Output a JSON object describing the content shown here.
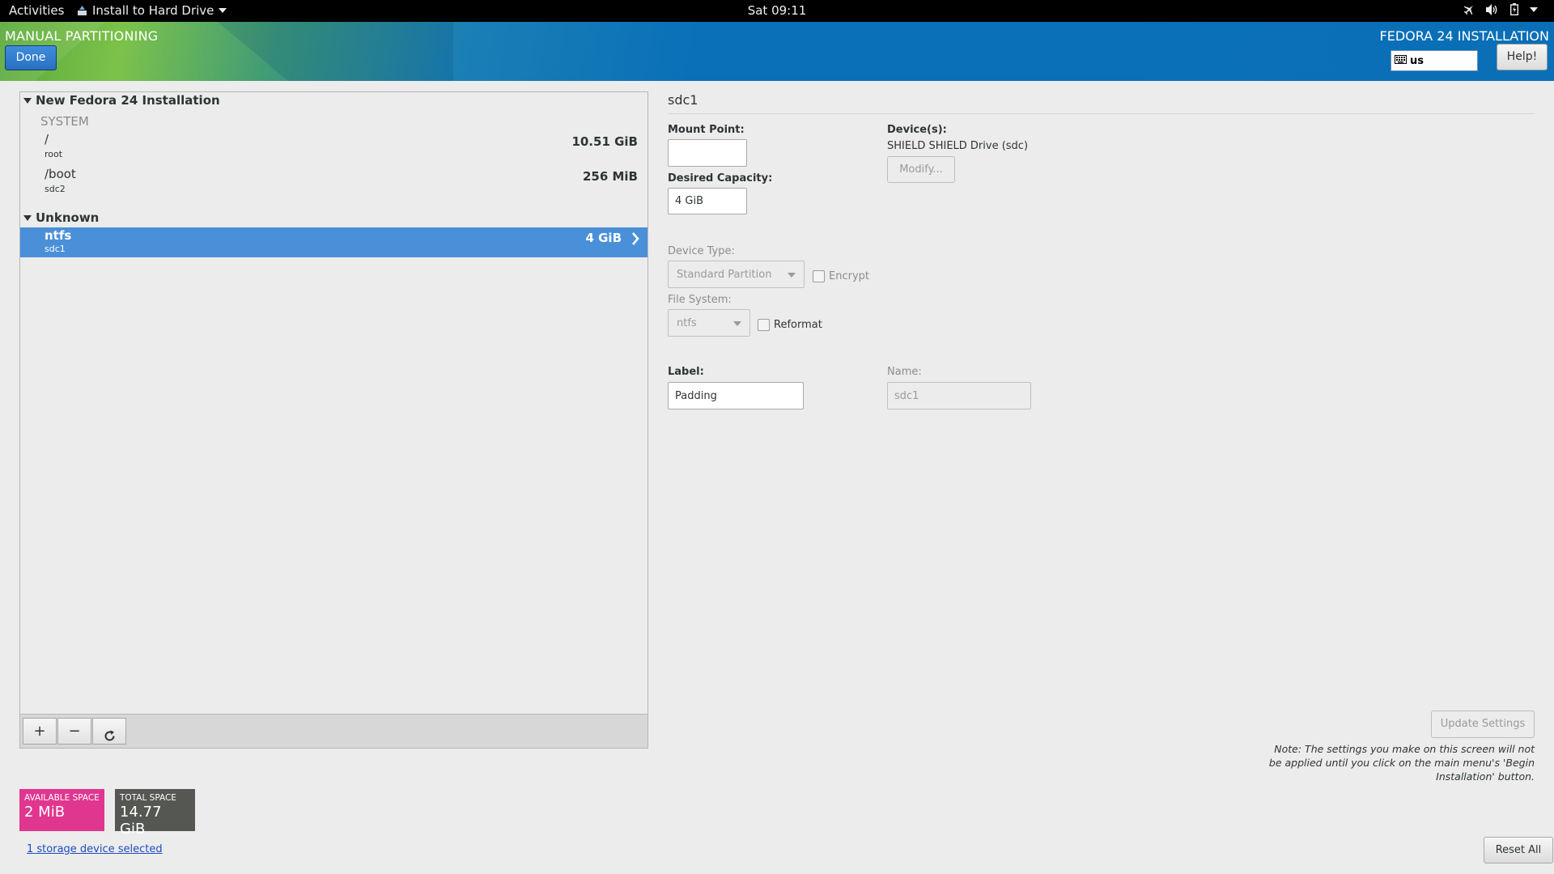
{
  "topbar": {
    "activities": "Activities",
    "app_menu": "Install to Hard Drive",
    "clock": "Sat 09:11",
    "tray_icons": [
      "airplane-icon",
      "volume-icon",
      "battery-icon",
      "system-menu-chevron-icon"
    ]
  },
  "header": {
    "title": "MANUAL PARTITIONING",
    "done_label": "Done",
    "install_title": "FEDORA 24 INSTALLATION",
    "keyboard_layout": "us",
    "help_label": "Help!"
  },
  "tree": {
    "new_install": {
      "title": "New Fedora 24 Installation",
      "system_label": "SYSTEM",
      "items": [
        {
          "mount": "/",
          "device": "root",
          "size": "10.51 GiB"
        },
        {
          "mount": "/boot",
          "device": "sdc2",
          "size": "256 MiB"
        }
      ]
    },
    "unknown": {
      "title": "Unknown",
      "items": [
        {
          "mount": "ntfs",
          "device": "sdc1",
          "size": "4 GiB",
          "selected": true
        }
      ]
    },
    "toolbar": {
      "add": "+",
      "remove": "−",
      "refresh": "refresh-icon"
    }
  },
  "space": {
    "available_label": "AVAILABLE SPACE",
    "available_value": "2 MiB",
    "available_color": "#e0368f",
    "total_label": "TOTAL SPACE",
    "total_value": "14.77 GiB",
    "total_color": "#555753"
  },
  "storage_link": "1 storage device selected",
  "detail": {
    "title": "sdc1",
    "mount_point_label": "Mount Point:",
    "mount_point_value": "",
    "desired_capacity_label": "Desired Capacity:",
    "desired_capacity_value": "4 GiB",
    "devices_label": "Device(s):",
    "devices_value": "SHIELD SHIELD Drive (sdc)",
    "modify_label": "Modify...",
    "device_type_label": "Device Type:",
    "device_type_value": "Standard Partition",
    "encrypt_label": "Encrypt",
    "file_system_label": "File System:",
    "file_system_value": "ntfs",
    "reformat_label": "Reformat",
    "label_label": "Label:",
    "label_value": "Padding",
    "name_label": "Name:",
    "name_value": "sdc1",
    "update_label": "Update Settings",
    "note": "Note:  The settings you make on this screen will not be applied until you click on the main menu's 'Begin Installation' button."
  },
  "reset_label": "Reset All"
}
